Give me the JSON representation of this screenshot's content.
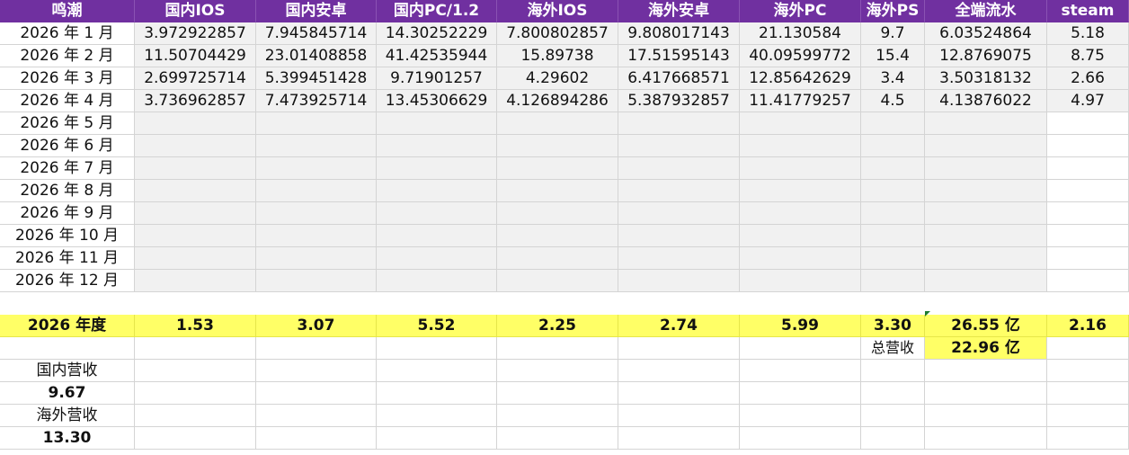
{
  "headers": [
    "鸣潮",
    "国内IOS",
    "国内安卓",
    "国内PC/1.2",
    "海外IOS",
    "海外安卓",
    "海外PC",
    "海外PS",
    "全端流水",
    "steam"
  ],
  "months": [
    {
      "label": "2026 年 1 月",
      "values": [
        "3.972922857",
        "7.945845714",
        "14.30252229",
        "7.800802857",
        "9.808017143",
        "21.130584",
        "9.7",
        "6.03524864",
        "5.18"
      ]
    },
    {
      "label": "2026 年 2 月",
      "values": [
        "11.50704429",
        "23.01408858",
        "41.42535944",
        "15.89738",
        "17.51595143",
        "40.09599772",
        "15.4",
        "12.8769075",
        "8.75"
      ]
    },
    {
      "label": "2026 年 3 月",
      "values": [
        "2.699725714",
        "5.399451428",
        "9.71901257",
        "4.29602",
        "6.417668571",
        "12.85642629",
        "3.4",
        "3.50318132",
        "2.66"
      ]
    },
    {
      "label": "2026 年 4 月",
      "values": [
        "3.736962857",
        "7.473925714",
        "13.45306629",
        "4.126894286",
        "5.387932857",
        "11.41779257",
        "4.5",
        "4.13876022",
        "4.97"
      ]
    },
    {
      "label": "2026 年 5 月",
      "values": [
        "",
        "",
        "",
        "",
        "",
        "",
        "",
        "",
        ""
      ]
    },
    {
      "label": "2026 年 6 月",
      "values": [
        "",
        "",
        "",
        "",
        "",
        "",
        "",
        "",
        ""
      ]
    },
    {
      "label": "2026 年 7 月",
      "values": [
        "",
        "",
        "",
        "",
        "",
        "",
        "",
        "",
        ""
      ]
    },
    {
      "label": "2026 年 8 月",
      "values": [
        "",
        "",
        "",
        "",
        "",
        "",
        "",
        "",
        ""
      ]
    },
    {
      "label": "2026 年 9 月",
      "values": [
        "",
        "",
        "",
        "",
        "",
        "",
        "",
        "",
        ""
      ]
    },
    {
      "label": "2026 年 10 月",
      "values": [
        "",
        "",
        "",
        "",
        "",
        "",
        "",
        "",
        ""
      ]
    },
    {
      "label": "2026 年 11 月",
      "values": [
        "",
        "",
        "",
        "",
        "",
        "",
        "",
        "",
        ""
      ]
    },
    {
      "label": "2026 年 12 月",
      "values": [
        "",
        "",
        "",
        "",
        "",
        "",
        "",
        "",
        ""
      ]
    }
  ],
  "annual": {
    "label": "2026 年度",
    "values": [
      "1.53",
      "3.07",
      "5.52",
      "2.25",
      "2.74",
      "5.99",
      "3.30",
      "26.55 亿",
      "2.16"
    ]
  },
  "total_revenue": {
    "label": "总营收",
    "value": "22.96 亿"
  },
  "domestic_revenue": {
    "label": "国内营收",
    "value": "9.67"
  },
  "overseas_revenue": {
    "label": "海外营收",
    "value": "13.30"
  },
  "colors": {
    "header_bg": "#7030a0",
    "highlight": "#ffff66",
    "shade": "#f1f1f1"
  }
}
